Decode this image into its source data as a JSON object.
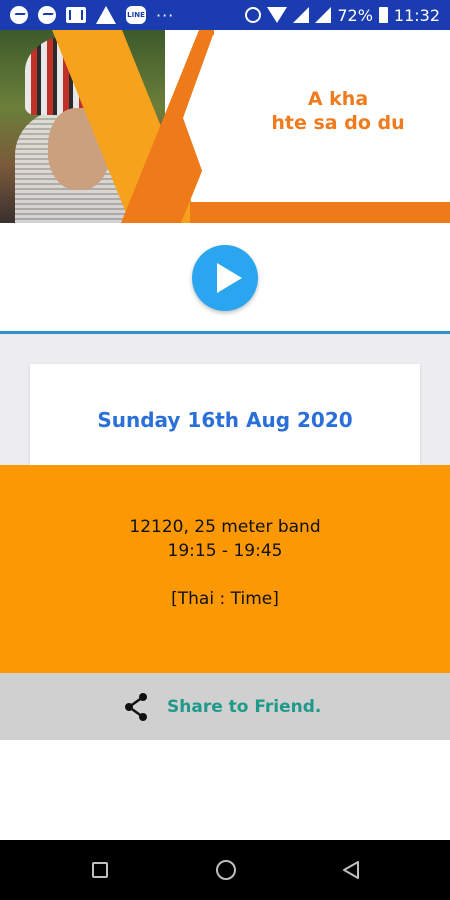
{
  "status_bar": {
    "battery_percent": "72%",
    "time": "11:32",
    "left_icons": [
      "messenger-icon",
      "messenger-icon",
      "gmail-icon",
      "warning-icon",
      "line-icon",
      "more-icon"
    ],
    "line_app_label": "LINE",
    "more_dots": "···",
    "right_icons": [
      "alarm-icon",
      "data-icon",
      "wifi-icon",
      "signal-icon",
      "signal-icon",
      "battery-icon"
    ]
  },
  "header": {
    "title_line1": "A kha",
    "title_line2": "hte sa do du",
    "accent_color": "#f07b1c"
  },
  "player": {
    "play_icon": "play-icon",
    "button_color": "#2aa6f0"
  },
  "broadcast": {
    "date": "Sunday 16th Aug 2020",
    "frequency": "12120, 25 meter band",
    "time_range": "19:15 - 19:45",
    "timezone": "[Thai : Time]",
    "block_color": "#fb9804"
  },
  "share": {
    "label": "Share  to Friend.",
    "icon": "share-icon"
  },
  "nav_bar": {
    "icons": [
      "recent-apps-icon",
      "home-icon",
      "back-icon"
    ]
  }
}
